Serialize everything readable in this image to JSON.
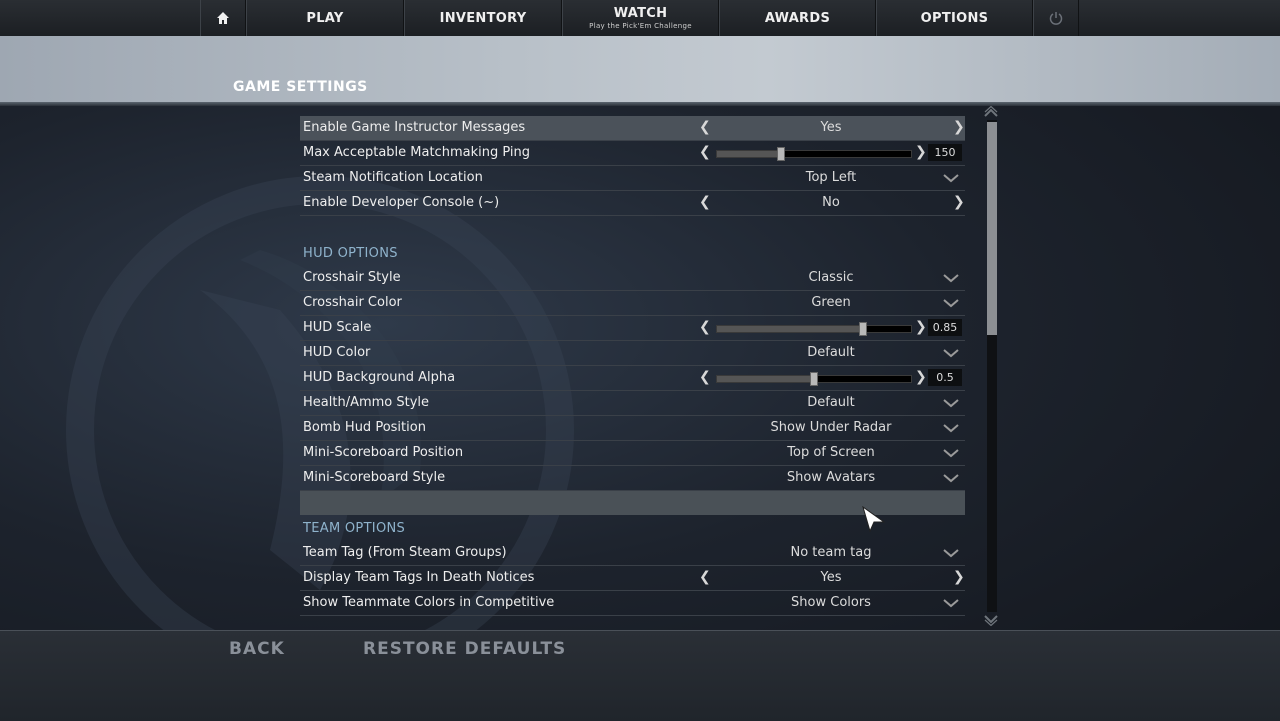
{
  "nav": {
    "items": [
      {
        "label": "PLAY",
        "sub": ""
      },
      {
        "label": "INVENTORY",
        "sub": ""
      },
      {
        "label": "WATCH",
        "sub": "Play the Pick'Em Challenge"
      },
      {
        "label": "AWARDS",
        "sub": ""
      },
      {
        "label": "OPTIONS",
        "sub": ""
      }
    ],
    "home_icon": "home-icon",
    "power_icon": "power-icon"
  },
  "header": {
    "title": "GAME SETTINGS"
  },
  "settings": {
    "rows": [
      {
        "label": "Enable Game Instructor Messages",
        "value": "Yes",
        "control": "arrows"
      },
      {
        "label": "Max Acceptable Matchmaking Ping",
        "value": "150",
        "control": "slider",
        "level": 0.33
      },
      {
        "label": "Steam Notification Location",
        "value": "Top Left",
        "control": "dropdown"
      },
      {
        "label": "Enable Developer Console (~)",
        "value": "No",
        "control": "arrows"
      }
    ],
    "hud_title": "HUD OPTIONS",
    "hud_rows": [
      {
        "label": "Crosshair Style",
        "value": "Classic",
        "control": "dropdown"
      },
      {
        "label": "Crosshair Color",
        "value": "Green",
        "control": "dropdown"
      },
      {
        "label": "HUD Scale",
        "value": "0.85",
        "control": "slider",
        "level": 0.75
      },
      {
        "label": "HUD Color",
        "value": "Default",
        "control": "dropdown"
      },
      {
        "label": "HUD Background Alpha",
        "value": "0.5",
        "control": "slider",
        "level": 0.5
      },
      {
        "label": "Health/Ammo Style",
        "value": "Default",
        "control": "dropdown"
      },
      {
        "label": "Bomb Hud Position",
        "value": "Show Under Radar",
        "control": "dropdown"
      },
      {
        "label": "Mini-Scoreboard Position",
        "value": "Top of Screen",
        "control": "dropdown"
      },
      {
        "label": "Mini-Scoreboard Style",
        "value": "Show Avatars",
        "control": "dropdown"
      }
    ],
    "team_title": "TEAM OPTIONS",
    "team_rows": [
      {
        "label": "Team Tag (From Steam Groups)",
        "value": "No team tag",
        "control": "dropdown"
      },
      {
        "label": "Display Team Tags In Death Notices",
        "value": "Yes",
        "control": "arrows"
      },
      {
        "label": "Show Teammate Colors in Competitive",
        "value": "Show Colors",
        "control": "dropdown"
      }
    ]
  },
  "footer": {
    "back": "BACK",
    "restore": "RESTORE DEFAULTS"
  },
  "colors": {
    "accent": "#8fb3cc",
    "header_band": "#b8c0c8",
    "active_row": "#4b525a"
  }
}
